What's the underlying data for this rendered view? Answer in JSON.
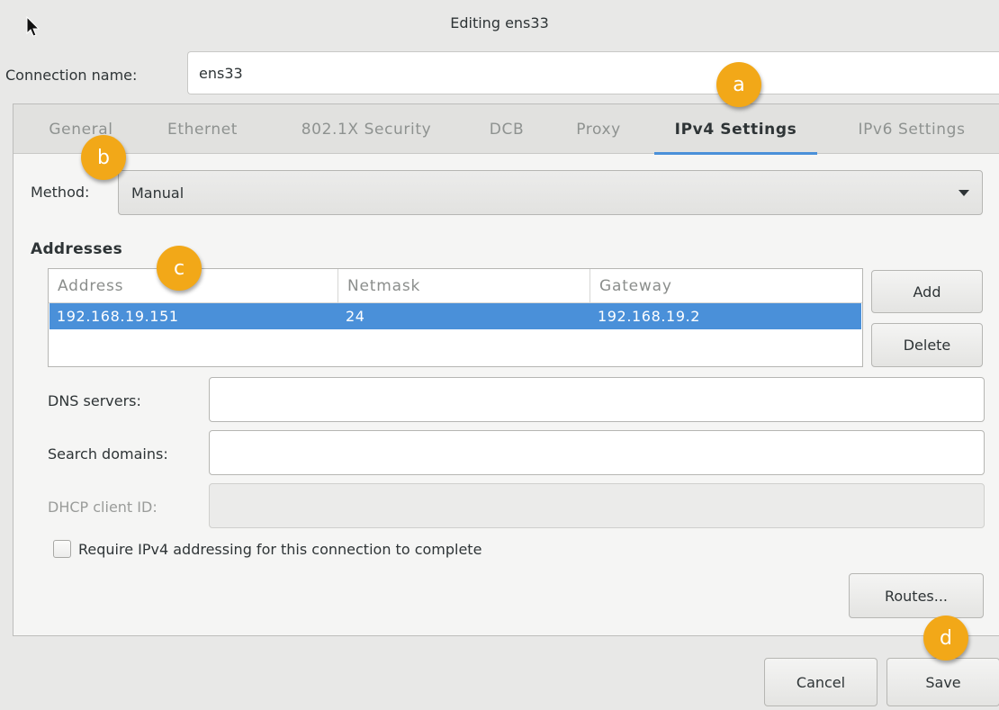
{
  "window": {
    "title": "Editing ens33"
  },
  "connection": {
    "label": "Connection name:",
    "value": "ens33"
  },
  "tabs": [
    {
      "label": "General"
    },
    {
      "label": "Ethernet"
    },
    {
      "label": "802.1X Security"
    },
    {
      "label": "DCB"
    },
    {
      "label": "Proxy"
    },
    {
      "label": "IPv4 Settings",
      "active": true
    },
    {
      "label": "IPv6 Settings"
    }
  ],
  "ipv4": {
    "method_label": "Method:",
    "method_value": "Manual",
    "addresses_heading": "Addresses",
    "columns": [
      "Address",
      "Netmask",
      "Gateway"
    ],
    "rows": [
      {
        "address": "192.168.19.151",
        "netmask": "24",
        "gateway": "192.168.19.2",
        "selected": true
      }
    ],
    "add_label": "Add",
    "delete_label": "Delete",
    "dns_label": "DNS servers:",
    "dns_value": "",
    "search_label": "Search domains:",
    "search_value": "",
    "dhcp_label": "DHCP client ID:",
    "dhcp_value": "",
    "require_label": "Require IPv4 addressing for this connection to complete",
    "require_checked": false,
    "routes_label": "Routes..."
  },
  "footer": {
    "cancel_label": "Cancel",
    "save_label": "Save"
  },
  "callouts": [
    "a",
    "b",
    "c",
    "d"
  ],
  "colors": {
    "accent": "#4a90d9",
    "badge": "#f2a818"
  }
}
